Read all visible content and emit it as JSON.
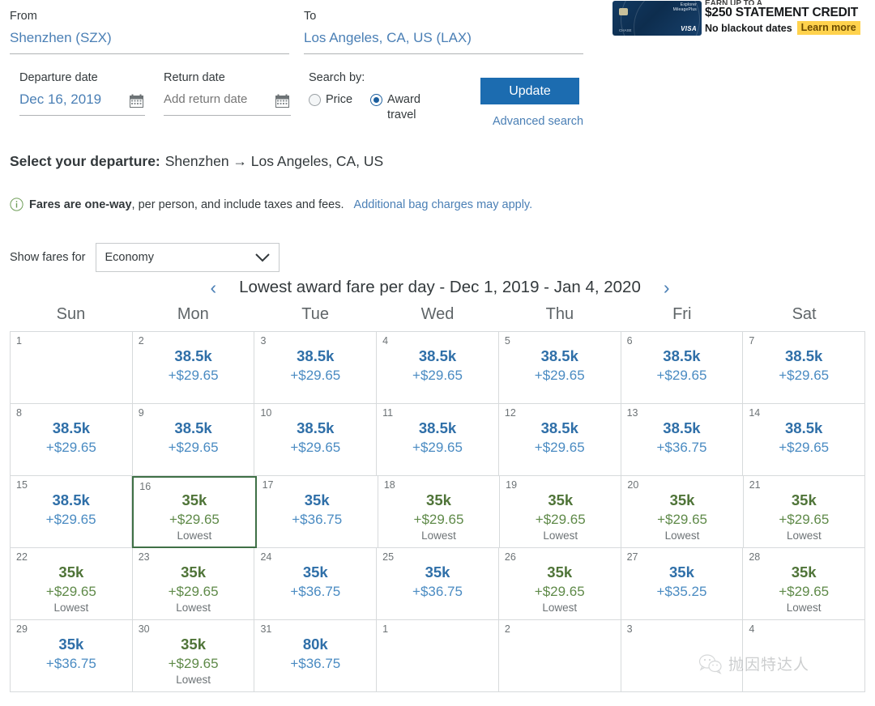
{
  "search": {
    "from": {
      "label": "From",
      "value": "Shenzhen (SZX)"
    },
    "to": {
      "label": "To",
      "value": "Los Angeles, CA, US (LAX)"
    },
    "departure": {
      "label": "Departure date",
      "value": "Dec 16, 2019"
    },
    "return": {
      "label": "Return date",
      "placeholder": "Add return date",
      "value": "Add return date"
    },
    "search_by": {
      "label": "Search by:",
      "options": [
        {
          "label": "Price",
          "selected": false
        },
        {
          "label": "Award travel",
          "selected": true
        }
      ],
      "selected": "Award travel"
    },
    "update_label": "Update",
    "advanced_label": "Advanced search"
  },
  "ad": {
    "line0": "EARN UP TO A",
    "headline": "$250 STATEMENT CREDIT",
    "subline": "No blackout dates",
    "cta": "Learn more",
    "card_brand": "VISA",
    "card_name": "Explorer",
    "card_program": "MileagePlus",
    "card_bank": "CHASE",
    "highlight_color": "#ffd24d"
  },
  "heading": {
    "prefix": "Select your departure:",
    "route": "Shenzhen → Los Angeles, CA, US"
  },
  "note": {
    "bold": "Fares are one-way",
    "rest": ", per person, and include taxes and fees.",
    "link": "Additional bag charges may apply."
  },
  "fare_filter": {
    "label": "Show fares for",
    "value": "Economy"
  },
  "calendar": {
    "prev": "‹",
    "next": "›",
    "title": "Lowest award fare per day - Dec 1, 2019 - Jan 4, 2020",
    "dow": [
      "Sun",
      "Mon",
      "Tue",
      "Wed",
      "Thu",
      "Fri",
      "Sat"
    ],
    "lowest_label": "Lowest",
    "selected_day": 16,
    "selected_color": "#3f7046",
    "fare_color": "#2f6fa8",
    "lowest_color": "#4f7438",
    "weeks": [
      [
        {
          "day": "1",
          "miles": "",
          "tax": "",
          "lowest": false
        },
        {
          "day": "2",
          "miles": "38.5k",
          "tax": "+$29.65",
          "lowest": false
        },
        {
          "day": "3",
          "miles": "38.5k",
          "tax": "+$29.65",
          "lowest": false
        },
        {
          "day": "4",
          "miles": "38.5k",
          "tax": "+$29.65",
          "lowest": false
        },
        {
          "day": "5",
          "miles": "38.5k",
          "tax": "+$29.65",
          "lowest": false
        },
        {
          "day": "6",
          "miles": "38.5k",
          "tax": "+$29.65",
          "lowest": false
        },
        {
          "day": "7",
          "miles": "38.5k",
          "tax": "+$29.65",
          "lowest": false
        }
      ],
      [
        {
          "day": "8",
          "miles": "38.5k",
          "tax": "+$29.65",
          "lowest": false
        },
        {
          "day": "9",
          "miles": "38.5k",
          "tax": "+$29.65",
          "lowest": false
        },
        {
          "day": "10",
          "miles": "38.5k",
          "tax": "+$29.65",
          "lowest": false
        },
        {
          "day": "11",
          "miles": "38.5k",
          "tax": "+$29.65",
          "lowest": false
        },
        {
          "day": "12",
          "miles": "38.5k",
          "tax": "+$29.65",
          "lowest": false
        },
        {
          "day": "13",
          "miles": "38.5k",
          "tax": "+$36.75",
          "lowest": false
        },
        {
          "day": "14",
          "miles": "38.5k",
          "tax": "+$29.65",
          "lowest": false
        }
      ],
      [
        {
          "day": "15",
          "miles": "38.5k",
          "tax": "+$29.65",
          "lowest": false
        },
        {
          "day": "16",
          "miles": "35k",
          "tax": "+$29.65",
          "lowest": true,
          "selected": true
        },
        {
          "day": "17",
          "miles": "35k",
          "tax": "+$36.75",
          "lowest": false
        },
        {
          "day": "18",
          "miles": "35k",
          "tax": "+$29.65",
          "lowest": true
        },
        {
          "day": "19",
          "miles": "35k",
          "tax": "+$29.65",
          "lowest": true
        },
        {
          "day": "20",
          "miles": "35k",
          "tax": "+$29.65",
          "lowest": true
        },
        {
          "day": "21",
          "miles": "35k",
          "tax": "+$29.65",
          "lowest": true
        }
      ],
      [
        {
          "day": "22",
          "miles": "35k",
          "tax": "+$29.65",
          "lowest": true
        },
        {
          "day": "23",
          "miles": "35k",
          "tax": "+$29.65",
          "lowest": true
        },
        {
          "day": "24",
          "miles": "35k",
          "tax": "+$36.75",
          "lowest": false
        },
        {
          "day": "25",
          "miles": "35k",
          "tax": "+$36.75",
          "lowest": false
        },
        {
          "day": "26",
          "miles": "35k",
          "tax": "+$29.65",
          "lowest": true
        },
        {
          "day": "27",
          "miles": "35k",
          "tax": "+$35.25",
          "lowest": false
        },
        {
          "day": "28",
          "miles": "35k",
          "tax": "+$29.65",
          "lowest": true
        }
      ],
      [
        {
          "day": "29",
          "miles": "35k",
          "tax": "+$36.75",
          "lowest": false
        },
        {
          "day": "30",
          "miles": "35k",
          "tax": "+$29.65",
          "lowest": true
        },
        {
          "day": "31",
          "miles": "80k",
          "tax": "+$36.75",
          "lowest": false
        },
        {
          "day": "1",
          "miles": "",
          "tax": "",
          "lowest": false
        },
        {
          "day": "2",
          "miles": "",
          "tax": "",
          "lowest": false
        },
        {
          "day": "3",
          "miles": "",
          "tax": "",
          "lowest": false
        },
        {
          "day": "4",
          "miles": "",
          "tax": "",
          "lowest": false
        }
      ]
    ]
  },
  "watermark": {
    "text": "抛因特达人"
  }
}
